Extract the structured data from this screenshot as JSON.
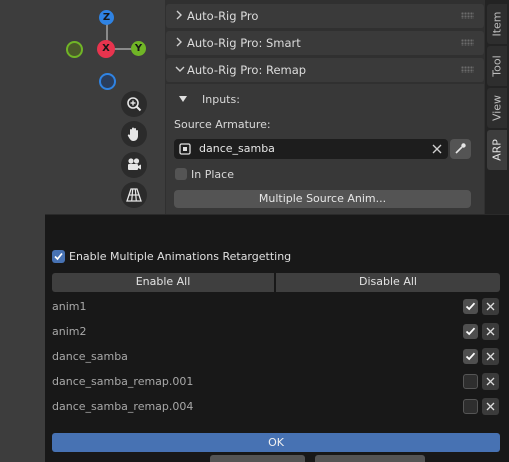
{
  "gizmo": {
    "axis_z": "Z",
    "axis_x": "X",
    "axis_y": "Y"
  },
  "sidebar_tabs": [
    "Item",
    "Tool",
    "View",
    "ARP"
  ],
  "panels": {
    "auto_rig_pro": "Auto-Rig Pro",
    "auto_rig_pro_smart": "Auto-Rig Pro: Smart",
    "auto_rig_pro_remap": "Auto-Rig Pro: Remap"
  },
  "remap": {
    "inputs_label": "Inputs:",
    "source_armature_label": "Source Armature:",
    "source_armature_value": "dance_samba",
    "in_place_label": "In Place",
    "multiple_source_button": "Multiple Source Anim..."
  },
  "popup": {
    "enable_multiple_label": "Enable Multiple Animations Retargetting",
    "enable_multiple_checked": true,
    "enable_all": "Enable All",
    "disable_all": "Disable All",
    "animations": [
      {
        "name": "anim1",
        "enabled": true
      },
      {
        "name": "anim2",
        "enabled": true
      },
      {
        "name": "dance_samba",
        "enabled": true
      },
      {
        "name": "dance_samba_remap.001",
        "enabled": false
      },
      {
        "name": "dance_samba_remap.004",
        "enabled": false
      }
    ],
    "ok": "OK"
  },
  "colors": {
    "accent": "#4772b3",
    "axis_x": "#e8344e",
    "axis_y": "#70b526",
    "axis_z": "#2f83e3"
  }
}
